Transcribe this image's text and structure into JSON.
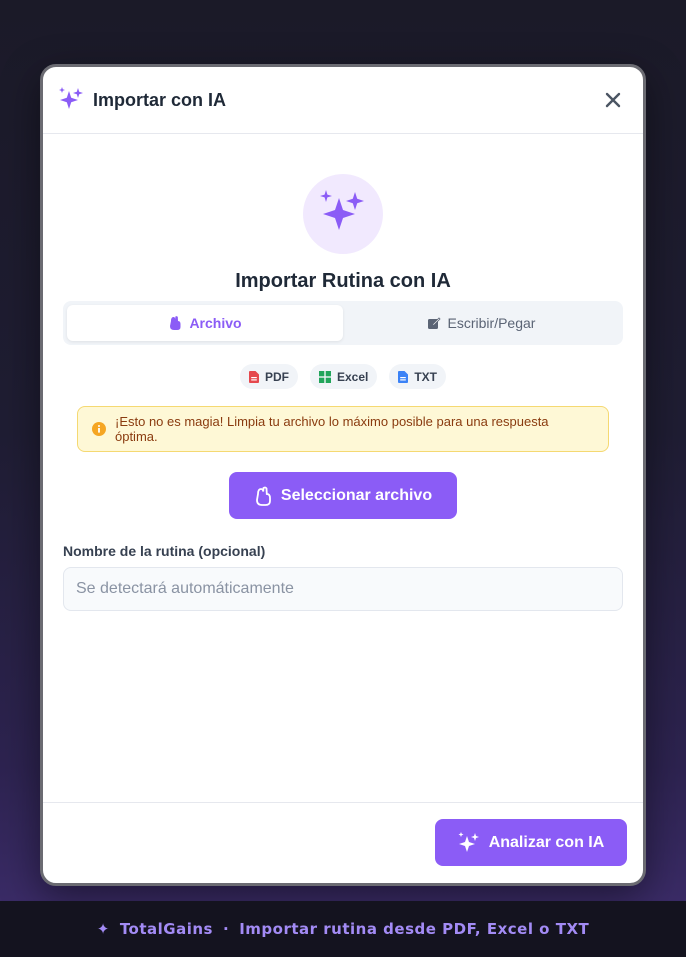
{
  "modal": {
    "title": "Importar con IA",
    "close_icon": "close-icon",
    "hero_title": "Importar Rutina con IA",
    "tabs": [
      {
        "label": "Archivo",
        "icon": "file-upload-icon",
        "active": true
      },
      {
        "label": "Escribir/Pegar",
        "icon": "edit-icon",
        "active": false
      }
    ],
    "formats": [
      {
        "label": "PDF",
        "icon": "pdf-file-icon",
        "color": "#e5484d"
      },
      {
        "label": "Excel",
        "icon": "excel-grid-icon",
        "color": "#22a55b"
      },
      {
        "label": "TXT",
        "icon": "text-file-icon",
        "color": "#3b82f6"
      }
    ],
    "alert": "¡Esto no es magia! Limpia tu archivo lo máximo posible para una respuesta óptima.",
    "select_button": "Seleccionar archivo",
    "name_label": "Nombre de la rutina (opcional)",
    "name_placeholder": "Se detectará automáticamente",
    "name_value": "",
    "analyze_button": "Analizar con IA"
  },
  "footer_bar": {
    "symbol": "✦",
    "brand": "TotalGains",
    "separator": "·",
    "text": "Importar rutina desde PDF, Excel o TXT"
  },
  "colors": {
    "accent": "#8b5cf6",
    "accent_light": "#f1e9fe",
    "warning_bg": "#fef8d6",
    "warning_text": "#8a3b0f"
  }
}
